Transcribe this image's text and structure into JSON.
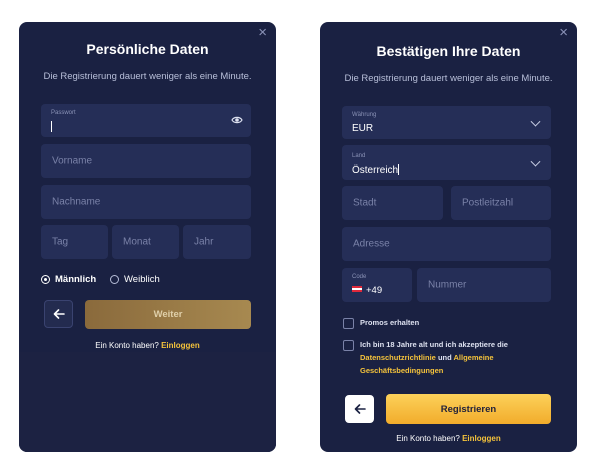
{
  "personal": {
    "close_icon": "×",
    "title": "Persönliche Daten",
    "subtitle": "Die Registrierung dauert weniger als eine Minute.",
    "password_label": "Passwort",
    "password_value": "",
    "firstname_placeholder": "Vorname",
    "lastname_placeholder": "Nachname",
    "day_placeholder": "Tag",
    "month_placeholder": "Monat",
    "year_placeholder": "Jahr",
    "gender_options": [
      {
        "label": "Männlich",
        "selected": true
      },
      {
        "label": "Weiblich",
        "selected": false
      }
    ],
    "back_icon": "arrow-left-icon",
    "next_button": "Weiter",
    "footer_text": "Ein Konto haben?",
    "login_link": "Einloggen"
  },
  "confirm": {
    "close_icon": "×",
    "title": "Bestätigen Ihre Daten",
    "subtitle": "Die Registrierung dauert weniger als eine Minute.",
    "currency_label": "Währung",
    "currency_value": "EUR",
    "country_label": "Land",
    "country_value": "Österreich",
    "city_placeholder": "Stadt",
    "zip_placeholder": "Postleitzahl",
    "address_placeholder": "Adresse",
    "code_label": "Code",
    "code_value": "+49",
    "phone_placeholder": "Nummer",
    "promos_label": "Promos erhalten",
    "terms_prefix": "Ich bin 18 Jahre alt und ich akzeptiere die",
    "privacy_link": "Datenschutzrichtlinie",
    "terms_and": "und",
    "terms_link_1": "Allgemeine",
    "terms_link_2": "Geschäftsbedingungen",
    "register_button": "Registrieren",
    "footer_text": "Ein Konto haben?",
    "login_link": "Einloggen"
  },
  "colors": {
    "modal_bg": "#1a2142",
    "field_bg": "#252e57",
    "accent": "#f5c33b"
  }
}
